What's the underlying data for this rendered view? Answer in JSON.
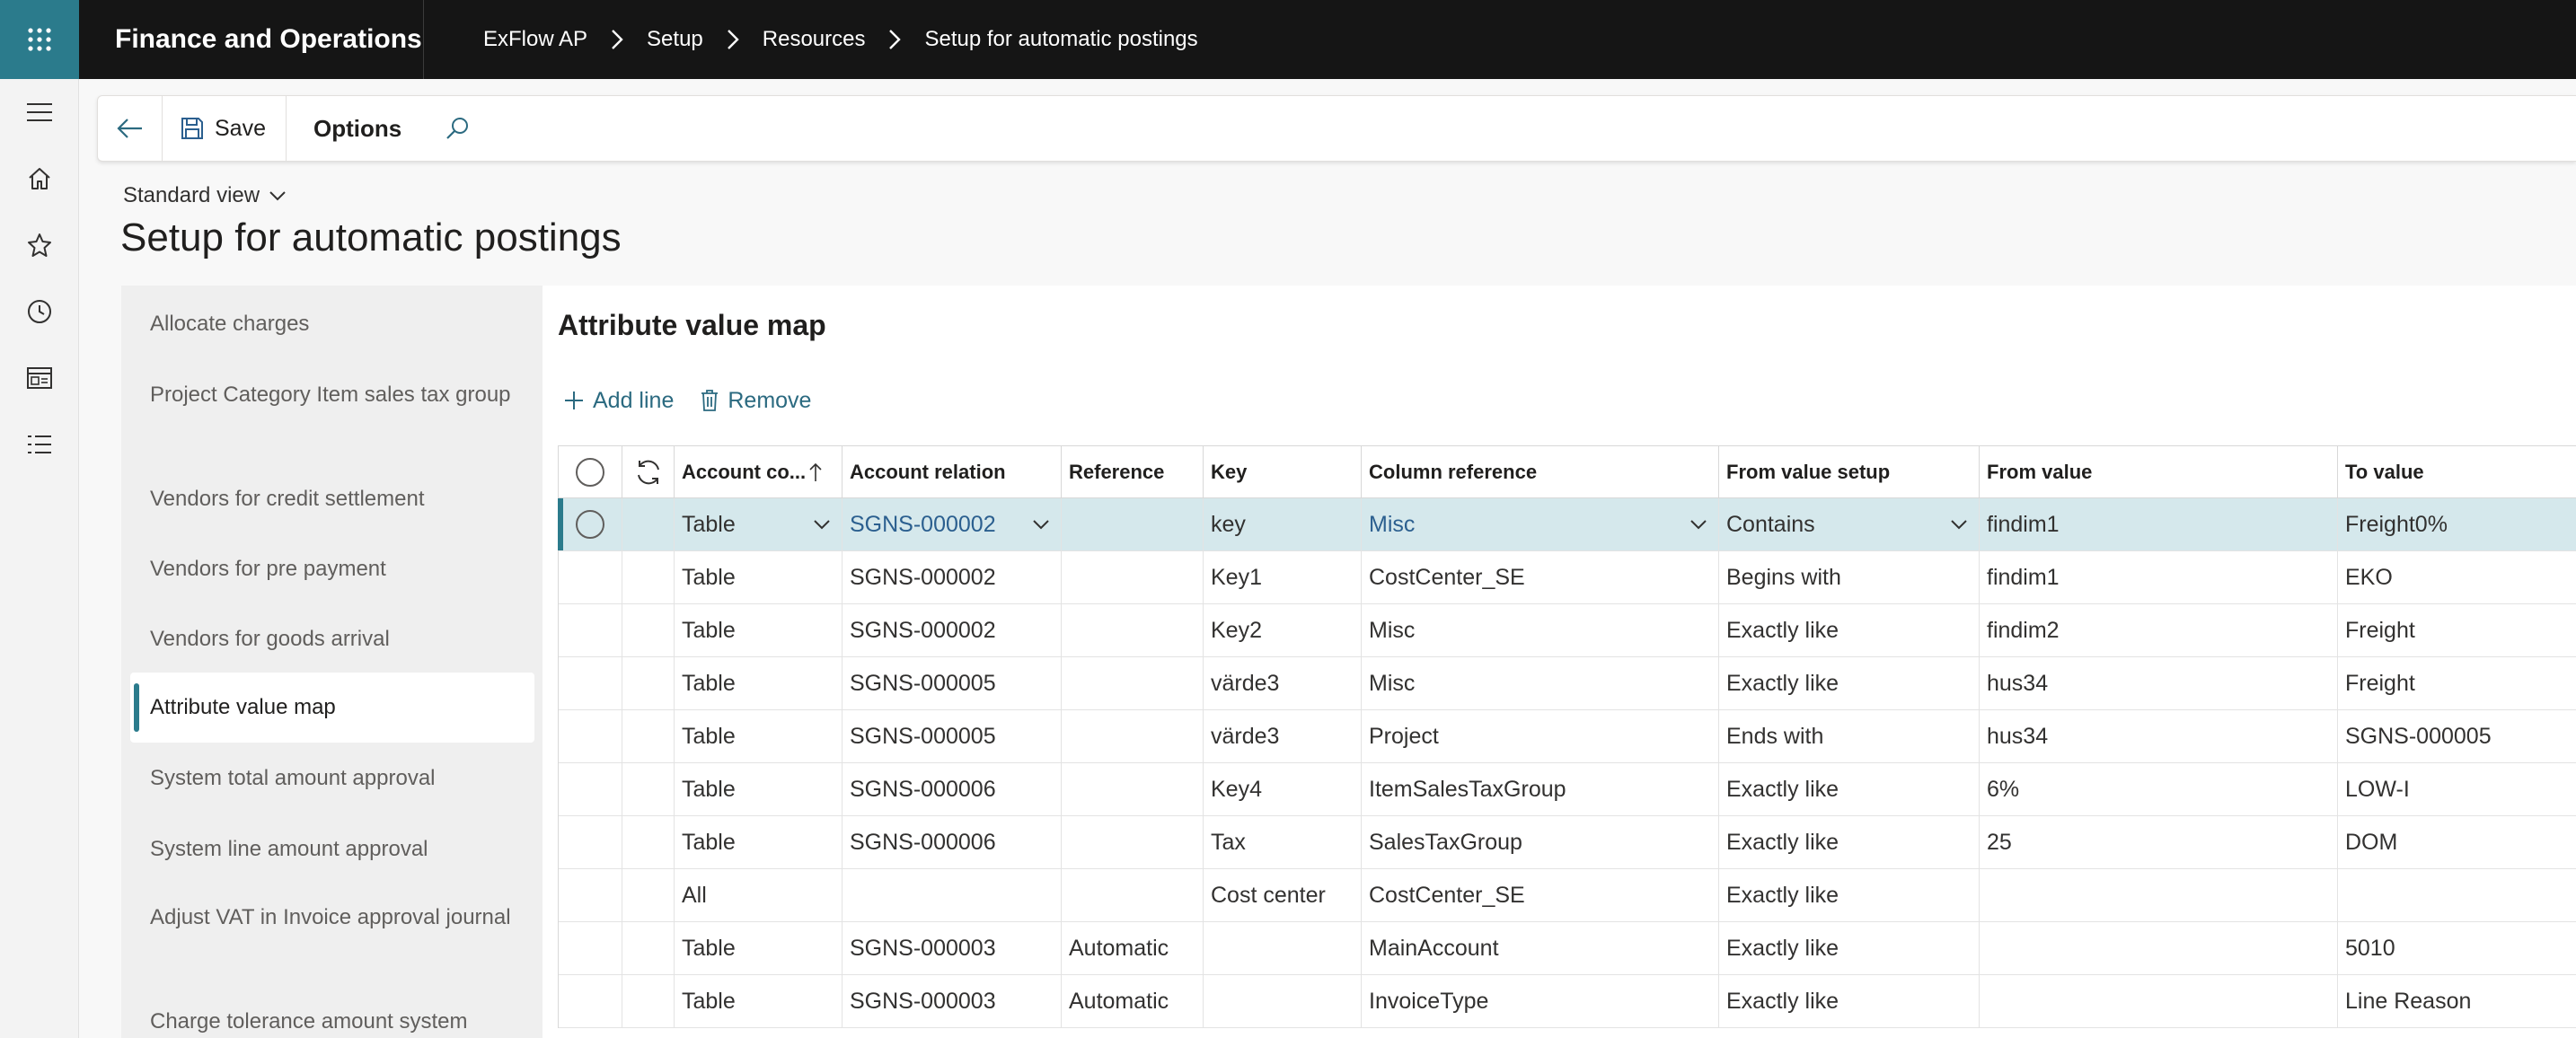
{
  "app": {
    "title": "Finance and Operations",
    "breadcrumb": [
      "ExFlow AP",
      "Setup",
      "Resources",
      "Setup for automatic postings"
    ]
  },
  "actions": {
    "save_label": "Save",
    "options_label": "Options"
  },
  "page": {
    "view_label": "Standard view",
    "title": "Setup for automatic postings"
  },
  "tabs": [
    {
      "label": "Allocate charges"
    },
    {
      "label": "Project Category Item sales tax group"
    },
    {
      "label": "Vendors for credit settlement"
    },
    {
      "label": "Vendors for pre payment"
    },
    {
      "label": "Vendors for goods arrival"
    },
    {
      "label": "Attribute value map",
      "active": true
    },
    {
      "label": "System total amount approval"
    },
    {
      "label": "System line amount approval"
    },
    {
      "label": "Adjust VAT in Invoice approval journal"
    },
    {
      "label": "Charge tolerance amount system"
    }
  ],
  "section": {
    "title": "Attribute value map",
    "add_line_label": "Add line",
    "remove_label": "Remove"
  },
  "grid": {
    "columns": [
      "Account co...",
      "Account relation",
      "Reference",
      "Key",
      "Column reference",
      "From value setup",
      "From value",
      "To value"
    ],
    "rows": [
      {
        "account_code": "Table",
        "account_relation": "SGNS-000002",
        "reference": "",
        "key": "key",
        "column_reference": "Misc",
        "from_value_setup": "Contains",
        "from_value": "findim1",
        "to_value": "Freight0%"
      },
      {
        "account_code": "Table",
        "account_relation": "SGNS-000002",
        "reference": "",
        "key": "Key1",
        "column_reference": "CostCenter_SE",
        "from_value_setup": "Begins with",
        "from_value": "findim1",
        "to_value": "EKO"
      },
      {
        "account_code": "Table",
        "account_relation": "SGNS-000002",
        "reference": "",
        "key": "Key2",
        "column_reference": "Misc",
        "from_value_setup": "Exactly like",
        "from_value": "findim2",
        "to_value": "Freight"
      },
      {
        "account_code": "Table",
        "account_relation": "SGNS-000005",
        "reference": "",
        "key": "värde3",
        "column_reference": "Misc",
        "from_value_setup": "Exactly like",
        "from_value": "hus34",
        "to_value": "Freight"
      },
      {
        "account_code": "Table",
        "account_relation": "SGNS-000005",
        "reference": "",
        "key": "värde3",
        "column_reference": "Project",
        "from_value_setup": "Ends with",
        "from_value": "hus34",
        "to_value": "SGNS-000005"
      },
      {
        "account_code": "Table",
        "account_relation": "SGNS-000006",
        "reference": "",
        "key": "Key4",
        "column_reference": "ItemSalesTaxGroup",
        "from_value_setup": "Exactly like",
        "from_value": "6%",
        "to_value": "LOW-I"
      },
      {
        "account_code": "Table",
        "account_relation": "SGNS-000006",
        "reference": "",
        "key": "Tax",
        "column_reference": "SalesTaxGroup",
        "from_value_setup": "Exactly like",
        "from_value": "25",
        "to_value": "DOM"
      },
      {
        "account_code": "All",
        "account_relation": "",
        "reference": "",
        "key": "Cost center",
        "column_reference": "CostCenter_SE",
        "from_value_setup": "Exactly like",
        "from_value": "",
        "to_value": ""
      },
      {
        "account_code": "Table",
        "account_relation": "SGNS-000003",
        "reference": "Automatic",
        "key": "",
        "column_reference": "MainAccount",
        "from_value_setup": "Exactly like",
        "from_value": "",
        "to_value": "5010"
      },
      {
        "account_code": "Table",
        "account_relation": "SGNS-000003",
        "reference": "Automatic",
        "key": "",
        "column_reference": "InvoiceType",
        "from_value_setup": "Exactly like",
        "from_value": "",
        "to_value": "Line Reason"
      }
    ]
  },
  "colors": {
    "accent": "#2b7b8c",
    "topbar": "#151515",
    "selected_row": "#d5e8ec",
    "link": "#2b5f8f"
  },
  "icons": [
    "waffle-icon",
    "chevron-right-icon",
    "hamburger-icon",
    "home-icon",
    "star-icon",
    "clock-icon",
    "workspace-icon",
    "modules-list-icon",
    "back-arrow-icon",
    "save-icon",
    "search-icon",
    "chevron-down-icon",
    "plus-icon",
    "trash-icon",
    "refresh-icon",
    "sort-up-icon"
  ]
}
